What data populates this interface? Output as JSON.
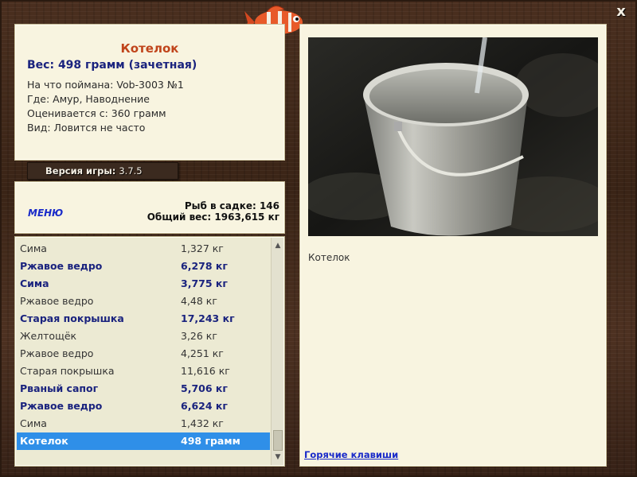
{
  "window": {
    "close_label": "x"
  },
  "catch": {
    "title": "Котелок",
    "weight_line": "Вес: 498 грамм (зачетная)",
    "details": [
      "На что поймана: Vob-3003 №1",
      "Где: Амур, Наводнение",
      "Оценивается с: 360 грамм",
      "Вид: Ловится не часто"
    ]
  },
  "version": {
    "label": "Версия игры:",
    "value": "3.7.5"
  },
  "menu": {
    "label": "МЕНЮ"
  },
  "stats": {
    "fish_in_cage": "Рыб в садке: 146",
    "total_weight": "Общий вес: 1963,615 кг"
  },
  "list": [
    {
      "name": "Сима",
      "weight": "1,327 кг",
      "bold": false,
      "selected": false
    },
    {
      "name": "Ржавое ведро",
      "weight": "6,278 кг",
      "bold": true,
      "selected": false
    },
    {
      "name": "Сима",
      "weight": "3,775 кг",
      "bold": true,
      "selected": false
    },
    {
      "name": "Ржавое ведро",
      "weight": "4,48 кг",
      "bold": false,
      "selected": false
    },
    {
      "name": "Старая покрышка",
      "weight": "17,243 кг",
      "bold": true,
      "selected": false
    },
    {
      "name": "Желтощёк",
      "weight": "3,26 кг",
      "bold": false,
      "selected": false
    },
    {
      "name": "Ржавое ведро",
      "weight": "4,251 кг",
      "bold": false,
      "selected": false
    },
    {
      "name": "Старая покрышка",
      "weight": "11,616 кг",
      "bold": false,
      "selected": false
    },
    {
      "name": "Рваный сапог",
      "weight": "5,706 кг",
      "bold": true,
      "selected": false
    },
    {
      "name": "Ржавое ведро",
      "weight": "6,624 кг",
      "bold": true,
      "selected": false
    },
    {
      "name": "Сима",
      "weight": "1,432 кг",
      "bold": false,
      "selected": false
    },
    {
      "name": "Котелок",
      "weight": "498 грамм",
      "bold": true,
      "selected": true
    }
  ],
  "photo": {
    "caption": "Котелок",
    "icon": "cooking-pot-photo"
  },
  "footer": {
    "hotkeys_label": "Горячие клавиши"
  },
  "colors": {
    "title": "#c0441b",
    "accent_text": "#1a237e",
    "link": "#1a2bc9",
    "selection": "#2f8fe8",
    "panel_bg": "#f8f4e0"
  }
}
